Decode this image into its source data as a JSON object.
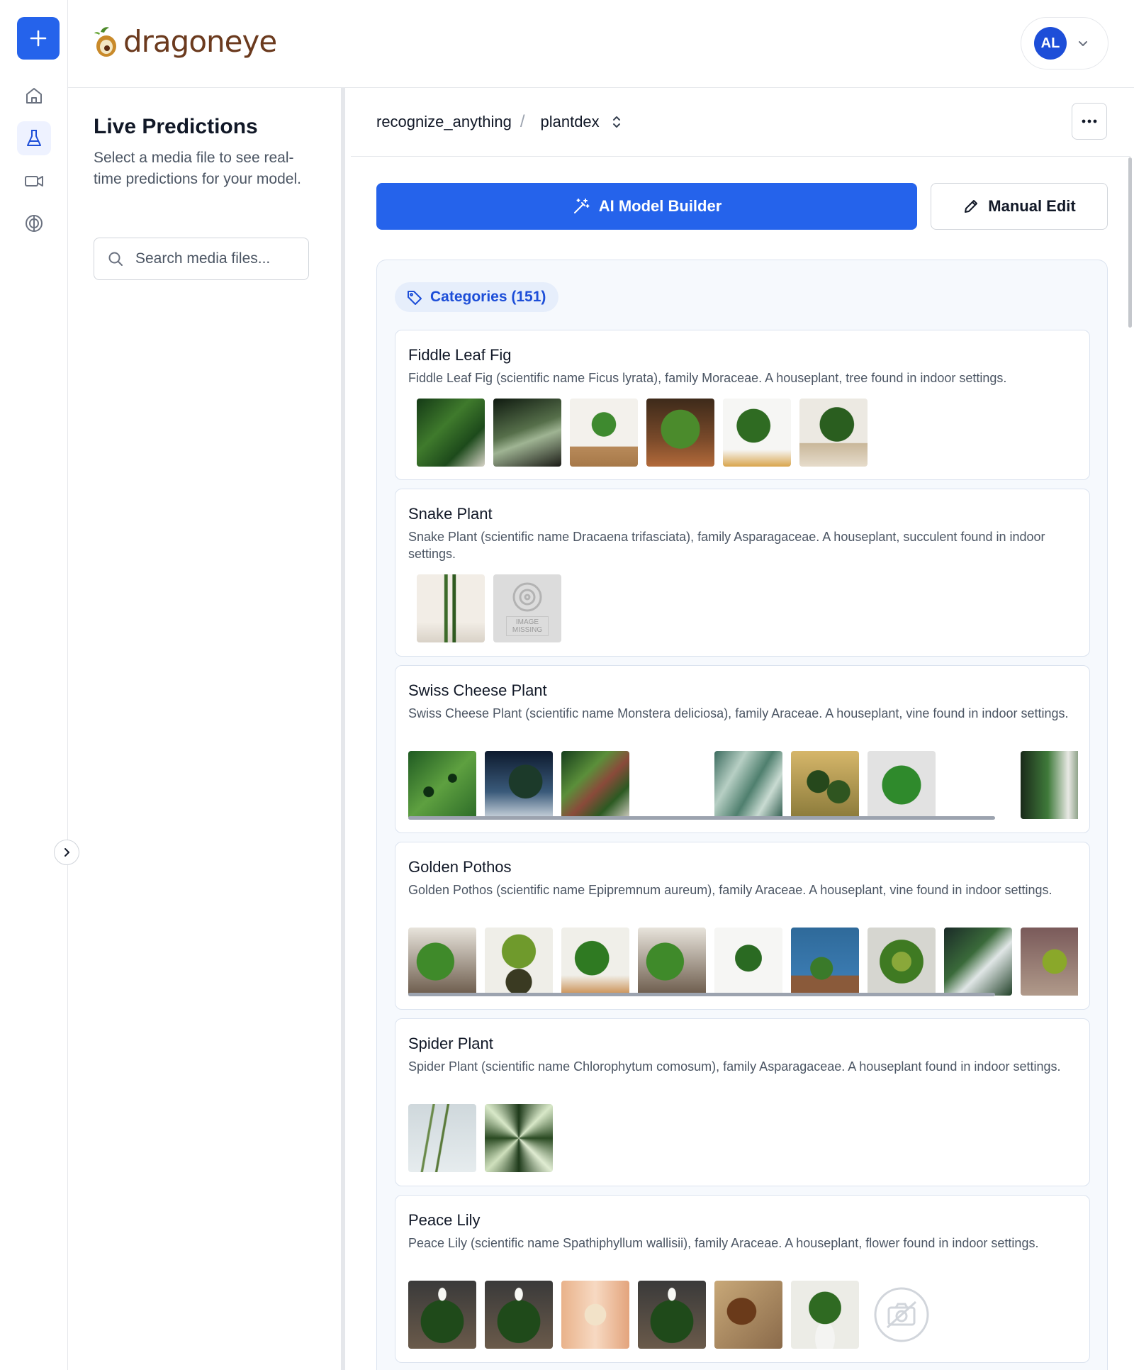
{
  "app": {
    "logo_text": "dragoneye",
    "user_initials": "AL",
    "brand_color": "#2563eb"
  },
  "rail": {
    "items": [
      {
        "icon": "plus-icon"
      },
      {
        "icon": "home-icon"
      },
      {
        "icon": "flask-icon",
        "active": true
      },
      {
        "icon": "video-icon"
      },
      {
        "icon": "brain-icon"
      }
    ]
  },
  "panel": {
    "title": "Live Predictions",
    "subtitle": "Select a media file to see real-time predictions for your model.",
    "search_placeholder": "Search media files..."
  },
  "breadcrumb": {
    "project": "recognize_anything",
    "separator": "/",
    "model": "plantdex"
  },
  "actions": {
    "ai_builder_label": "AI Model Builder",
    "manual_edit_label": "Manual Edit"
  },
  "categories": {
    "label": "Categories (151)",
    "items": [
      {
        "name": "Fiddle Leaf Fig",
        "description": "Fiddle Leaf Fig (scientific name Ficus lyrata), family Moraceae. A houseplant, tree found in indoor settings.",
        "images": [
          "plant-photo",
          "plant-photo",
          "plant-photo",
          "plant-photo",
          "plant-photo",
          "plant-photo"
        ]
      },
      {
        "name": "Snake Plant",
        "description": "Snake Plant (scientific name Dracaena trifasciata), family Asparagaceae. A houseplant, succulent found in indoor settings.",
        "images": [
          "plant-photo",
          "image-missing"
        ],
        "missing_text": "IMAGE MISSING"
      },
      {
        "name": "Swiss Cheese Plant",
        "description": "Swiss Cheese Plant (scientific name Monstera deliciosa), family Araceae. A houseplant, vine found in indoor settings.",
        "images": [
          "plant-photo",
          "plant-photo",
          "plant-photo",
          "blank",
          "plant-photo",
          "plant-photo",
          "plant-photo",
          "blank",
          "plant-photo"
        ]
      },
      {
        "name": "Golden Pothos",
        "description": "Golden Pothos (scientific name Epipremnum aureum), family Araceae. A houseplant, vine found in indoor settings.",
        "images": [
          "plant-photo",
          "plant-photo",
          "plant-photo",
          "plant-photo",
          "plant-photo",
          "plant-photo",
          "plant-photo",
          "plant-photo",
          "plant-photo"
        ]
      },
      {
        "name": "Spider Plant",
        "description": "Spider Plant (scientific name Chlorophytum comosum), family Asparagaceae. A houseplant found in indoor settings.",
        "images": [
          "plant-photo",
          "plant-photo"
        ]
      },
      {
        "name": "Peace Lily",
        "description": "Peace Lily (scientific name Spathiphyllum wallisii), family Araceae. A houseplant, flower found in indoor settings.",
        "images": [
          "plant-photo",
          "plant-photo",
          "plant-photo",
          "plant-photo",
          "plant-photo",
          "plant-photo",
          "camera-placeholder"
        ]
      }
    ]
  }
}
